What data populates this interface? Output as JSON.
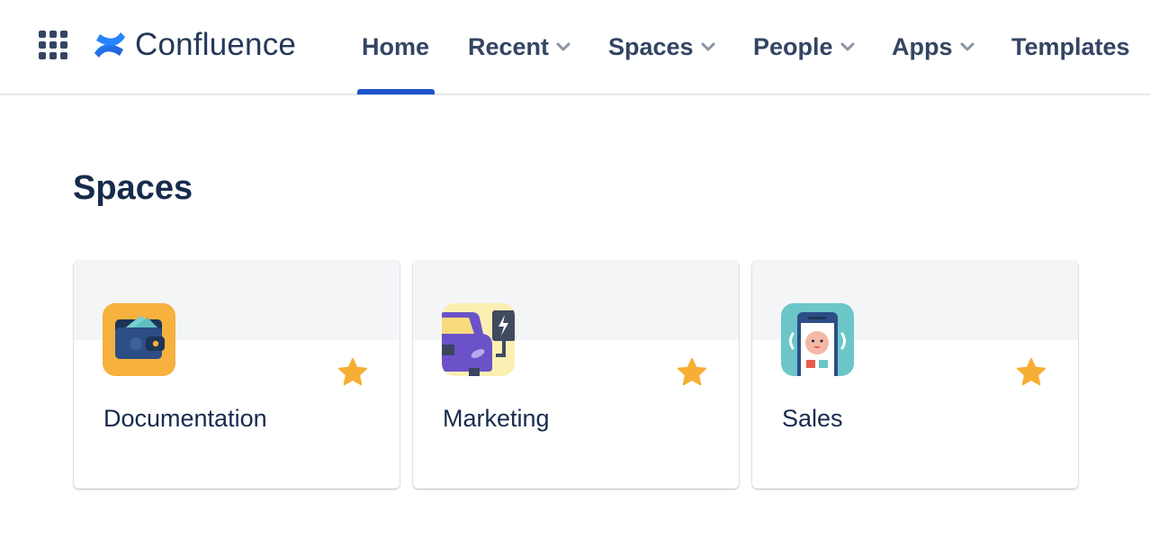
{
  "app": {
    "name": "Confluence",
    "brand_color": "#2684FF",
    "accent_color": "#1D55C9"
  },
  "header": {
    "app_switcher_icon": "grid-icon",
    "logo_icon": "confluence-logo-icon",
    "logo_text": "Confluence",
    "nav": [
      {
        "label": "Home",
        "active": true,
        "dropdown": false
      },
      {
        "label": "Recent",
        "active": false,
        "dropdown": true
      },
      {
        "label": "Spaces",
        "active": false,
        "dropdown": true
      },
      {
        "label": "People",
        "active": false,
        "dropdown": true
      },
      {
        "label": "Apps",
        "active": false,
        "dropdown": true
      },
      {
        "label": "Templates",
        "active": false,
        "dropdown": false
      }
    ]
  },
  "main": {
    "title": "Spaces",
    "spaces": [
      {
        "name": "Documentation",
        "icon": "wallet-icon",
        "starred": true,
        "icon_bg": "#F6B13E"
      },
      {
        "name": "Marketing",
        "icon": "electric-car-icon",
        "starred": true,
        "icon_bg": "#FBEFB3"
      },
      {
        "name": "Sales",
        "icon": "phone-face-icon",
        "starred": true,
        "icon_bg": "#6CC6C8"
      }
    ],
    "star_color": "#F6AE35"
  }
}
